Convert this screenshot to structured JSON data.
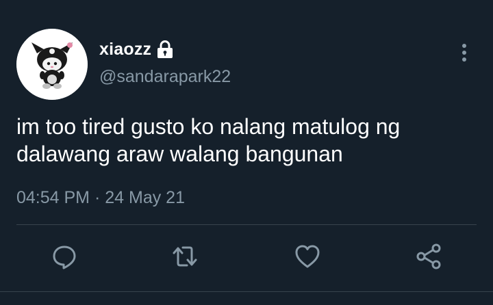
{
  "tweet": {
    "user": {
      "display_name": "xiaozz",
      "handle": "@sandarapark22",
      "protected_icon": "lock-icon",
      "avatar": "plush-toy-avatar"
    },
    "text_lines": [
      "im too tired gusto ko nalang matulog ng",
      "dalawang araw walang bangunan"
    ],
    "time": "04:54 PM",
    "separator": "·",
    "date": "24 May 21",
    "menu_icon": "more-vertical-icon"
  },
  "actions": [
    {
      "name": "reply",
      "icon": "reply-icon"
    },
    {
      "name": "retweet",
      "icon": "retweet-icon"
    },
    {
      "name": "like",
      "icon": "heart-icon"
    },
    {
      "name": "share",
      "icon": "share-icon"
    }
  ],
  "colors": {
    "background": "#15202b",
    "primary_text": "#ffffff",
    "secondary_text": "#8899a6",
    "divider": "#38444d"
  }
}
